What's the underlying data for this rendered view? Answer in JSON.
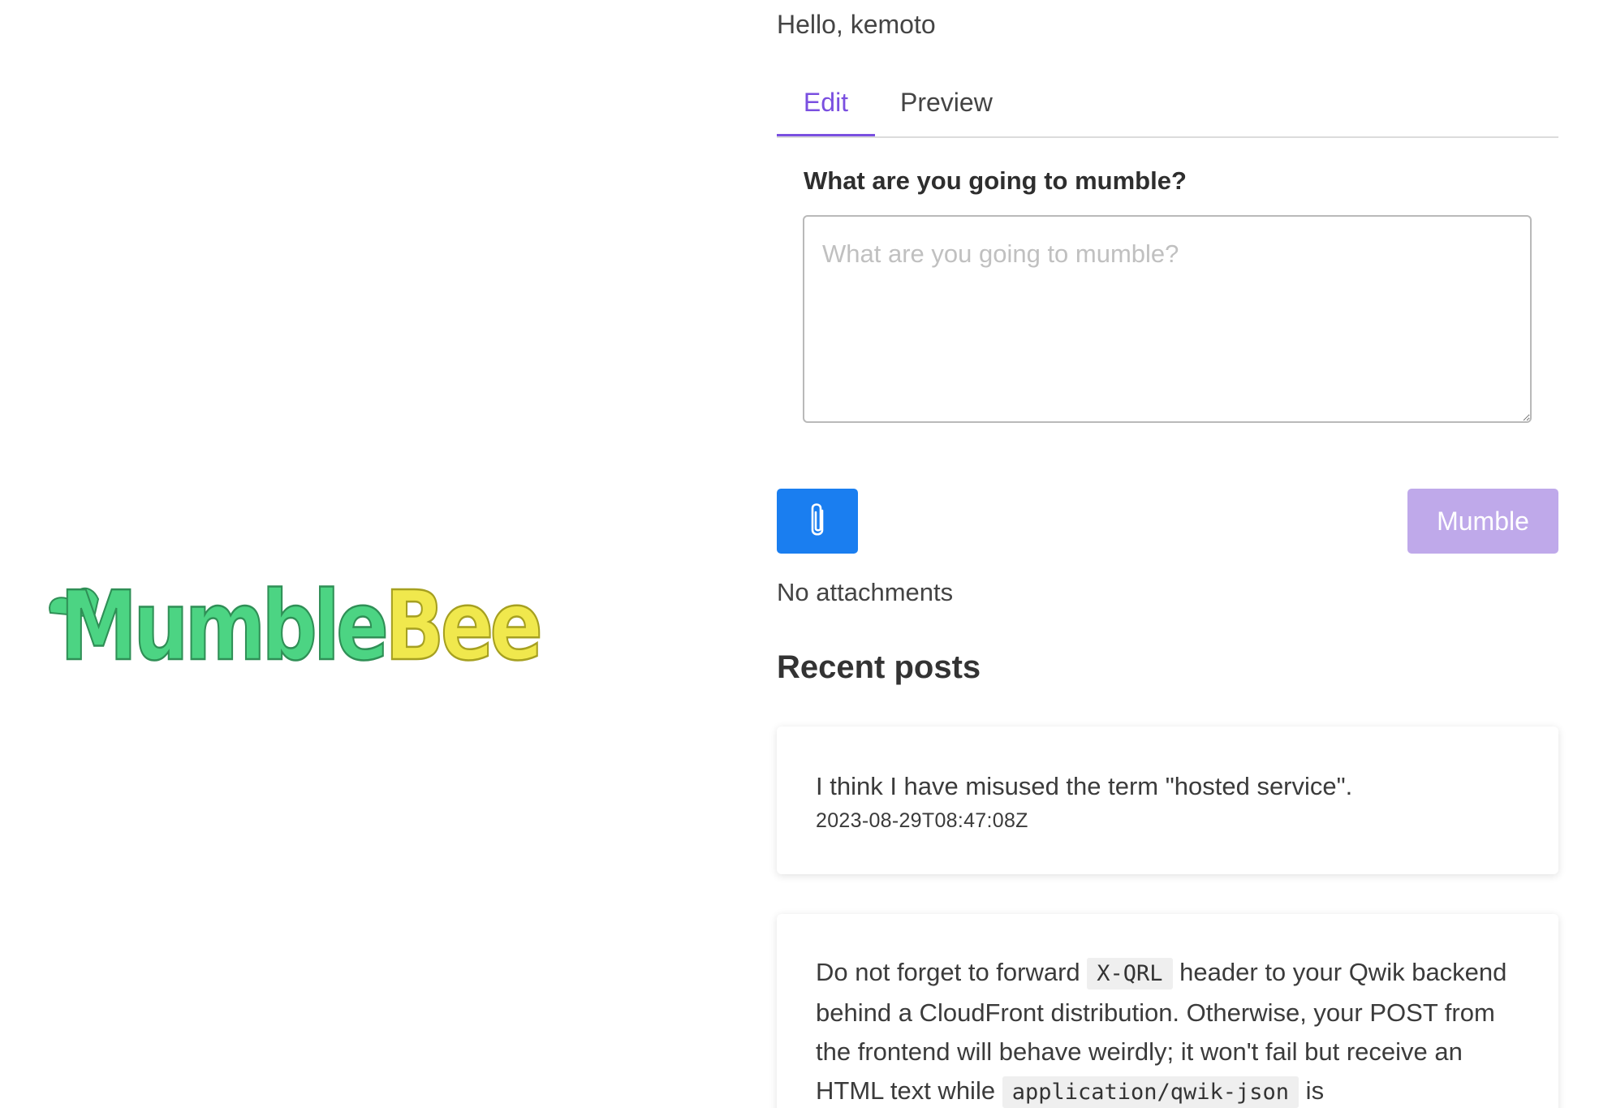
{
  "logo": {
    "text_part1": "Mumble",
    "text_part2": "Bee",
    "color_part1": "#4cd483",
    "color_part2": "#f0e84d"
  },
  "greeting": "Hello, kemoto",
  "tabs": [
    {
      "label": "Edit",
      "active": true
    },
    {
      "label": "Preview",
      "active": false
    }
  ],
  "editor": {
    "label": "What are you going to mumble?",
    "placeholder": "What are you going to mumble?",
    "value": ""
  },
  "actions": {
    "attach_icon": "paperclip-icon",
    "mumble_label": "Mumble"
  },
  "attachments_status": "No attachments",
  "recent": {
    "title": "Recent posts",
    "posts": [
      {
        "text": "I think I have misused the term \"hosted service\".",
        "date": "2023-08-29T08:47:08Z"
      },
      {
        "text_parts": [
          "Do not forget to forward ",
          "X-QRL",
          " header to your Qwik backend behind a CloudFront distribution. Otherwise, your POST from the frontend will behave weirdly; it won't fail but receive an HTML text while ",
          "application/qwik-json",
          " is"
        ]
      }
    ]
  },
  "colors": {
    "accent": "#7a4fe0",
    "attach_button": "#1a7ef0",
    "mumble_button_disabled": "#bfa9ea"
  }
}
